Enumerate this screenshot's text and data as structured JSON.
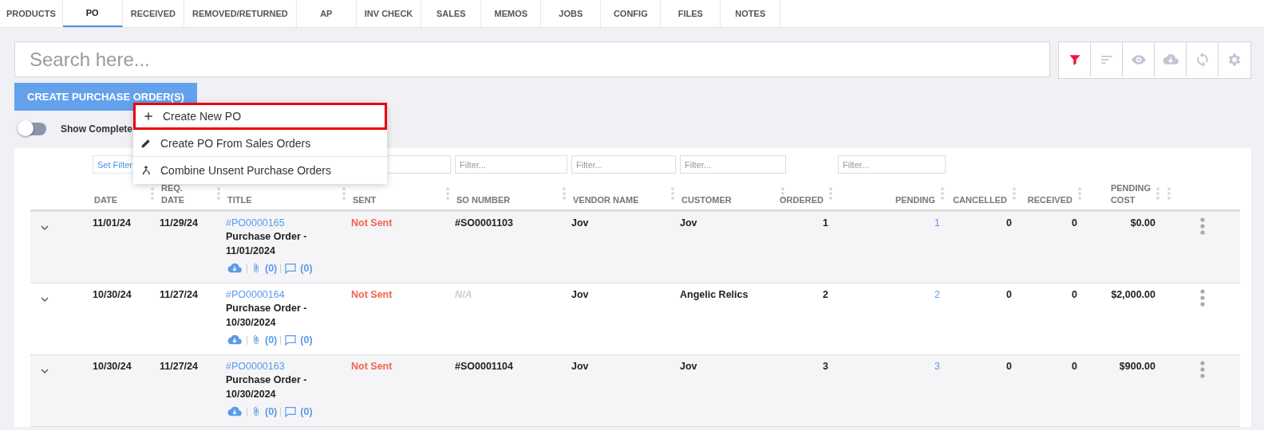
{
  "tabs": [
    {
      "label": "PRODUCTS",
      "selected": false
    },
    {
      "label": "PO",
      "selected": true
    },
    {
      "label": "RECEIVED",
      "selected": false
    },
    {
      "label": "REMOVED/RETURNED",
      "selected": false
    },
    {
      "label": "AP",
      "selected": false
    },
    {
      "label": "INV CHECK",
      "selected": false
    },
    {
      "label": "SALES",
      "selected": false
    },
    {
      "label": "MEMOS",
      "selected": false
    },
    {
      "label": "JOBS",
      "selected": false
    },
    {
      "label": "CONFIG",
      "selected": false
    },
    {
      "label": "FILES",
      "selected": false
    },
    {
      "label": "NOTES",
      "selected": false
    }
  ],
  "search": {
    "placeholder": "Search here..."
  },
  "toolbar": [
    {
      "kind": "filter",
      "active": true
    },
    {
      "kind": "sort",
      "active": false
    },
    {
      "kind": "eye",
      "active": false
    },
    {
      "kind": "download",
      "active": false
    },
    {
      "kind": "sync",
      "active": false
    },
    {
      "kind": "settings",
      "active": false
    }
  ],
  "create_button": "CREATE PURCHASE ORDER(S)",
  "menu": [
    {
      "kind": "add",
      "label": "Create New PO",
      "selected": true
    },
    {
      "kind": "edit",
      "label": "Create PO From Sales Orders",
      "selected": false
    },
    {
      "kind": "combine",
      "label": "Combine Unsent Purchase Orders",
      "selected": false
    }
  ],
  "show_completed": {
    "label": "Show Complete",
    "on": false
  },
  "table": {
    "filters": [
      {
        "kind": "none"
      },
      {
        "kind": "set",
        "label": "Set Filter"
      },
      {
        "kind": "none"
      },
      {
        "kind": "none"
      },
      {
        "kind": "text"
      },
      {
        "kind": "text",
        "placeholder": "Filter..."
      },
      {
        "kind": "text",
        "placeholder": "Filter..."
      },
      {
        "kind": "text",
        "placeholder": "Filter..."
      },
      {
        "kind": "none"
      },
      {
        "kind": "text",
        "placeholder": "Filter..."
      },
      {
        "kind": "none"
      },
      {
        "kind": "none"
      },
      {
        "kind": "none"
      },
      {
        "kind": "none"
      }
    ],
    "columns": [
      "",
      "DATE",
      "REQ.\nDATE",
      "TITLE",
      "SENT",
      "SO NUMBER",
      "VENDOR NAME",
      "CUSTOMER",
      "ORDERED",
      "PENDING",
      "CANCELLED",
      "RECEIVED",
      "PENDING\nCOST",
      ""
    ],
    "rows": [
      {
        "date": "11/01/24",
        "req_date": "11/29/24",
        "po": "#PO0000165",
        "title": "Purchase Order - 11/01/2024",
        "attachments": "(0)",
        "comments": "(0)",
        "sent": "Not Sent",
        "so_number": {
          "text": "#SO0001103",
          "missing": false
        },
        "vendor": "Jov",
        "customer": "Jov",
        "ordered": "1",
        "pending": "1",
        "cancelled": "0",
        "received": "0",
        "pending_cost": "$0.00"
      },
      {
        "date": "10/30/24",
        "req_date": "11/27/24",
        "po": "#PO0000164",
        "title": "Purchase Order - 10/30/2024",
        "attachments": "(0)",
        "comments": "(0)",
        "sent": "Not Sent",
        "so_number": {
          "text": "N/A",
          "missing": true
        },
        "vendor": "Jov",
        "customer": "Angelic Relics",
        "ordered": "2",
        "pending": "2",
        "cancelled": "0",
        "received": "0",
        "pending_cost": "$2,000.00"
      },
      {
        "date": "10/30/24",
        "req_date": "11/27/24",
        "po": "#PO0000163",
        "title": "Purchase Order - 10/30/2024",
        "attachments": "(0)",
        "comments": "(0)",
        "sent": "Not Sent",
        "so_number": {
          "text": "#SO0001104",
          "missing": false
        },
        "vendor": "Jov",
        "customer": "Jov",
        "ordered": "3",
        "pending": "3",
        "cancelled": "0",
        "received": "0",
        "pending_cost": "$900.00"
      }
    ]
  }
}
